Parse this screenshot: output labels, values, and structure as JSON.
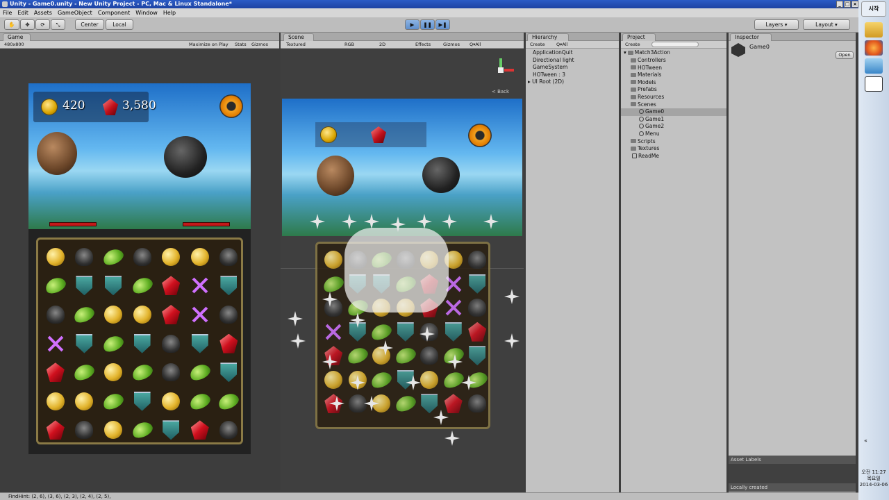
{
  "window": {
    "title": "Unity - Game0.unity - New Unity Project - PC, Mac & Linux Standalone*"
  },
  "menu": [
    "File",
    "Edit",
    "Assets",
    "GameObject",
    "Component",
    "Window",
    "Help"
  ],
  "toolbar": {
    "pivot": "Center",
    "space": "Local",
    "layers": "Layers",
    "layout": "Layout"
  },
  "game_panel": {
    "tab": "Game",
    "aspect": "480x800",
    "maximize": "Maximize on Play",
    "stats": "Stats",
    "gizmos": "Gizmos"
  },
  "scene_panel": {
    "tab": "Scene",
    "shading": "Textured",
    "render": "RGB",
    "mode2d": "2D",
    "effects": "Effects",
    "gizmos": "Gizmos",
    "search": "Q▾All",
    "back": "< Back"
  },
  "hierarchy": {
    "tab": "Hierarchy",
    "create": "Create",
    "search": "Q▾All",
    "items": [
      "ApplicationQuit",
      "Directional light",
      "GameSystem",
      "HOTween : 3",
      "▸ UI Root (2D)"
    ]
  },
  "project": {
    "tab": "Project",
    "create": "Create",
    "root": "Match3Action",
    "folders": [
      "Controllers",
      "HOTween",
      "Materials",
      "Models",
      "Prefabs",
      "Resources",
      "Scenes"
    ],
    "scenes": [
      "Game0",
      "Game1",
      "Game2",
      "Menu"
    ],
    "after": [
      "Scripts",
      "Textures"
    ],
    "file": "ReadMe"
  },
  "inspector": {
    "tab": "Inspector",
    "object": "Game0",
    "open": "Open",
    "asset_labels": "Asset Labels",
    "locally_created": "Locally created"
  },
  "game": {
    "coins": "420",
    "gems": "3,580"
  },
  "board_rows": [
    [
      "coin",
      "skull",
      "leaf",
      "skull",
      "coin",
      "coin",
      "skull"
    ],
    [
      "leaf",
      "shield",
      "shield",
      "leaf",
      "ruby",
      "sword",
      "shield"
    ],
    [
      "skull",
      "leaf",
      "coin",
      "coin",
      "ruby",
      "sword",
      "skull"
    ],
    [
      "sword",
      "shield",
      "leaf",
      "shield",
      "skull",
      "shield",
      "ruby"
    ],
    [
      "ruby",
      "leaf",
      "coin",
      "leaf",
      "skull",
      "leaf",
      "shield"
    ],
    [
      "coin",
      "coin",
      "leaf",
      "shield",
      "coin",
      "leaf",
      "leaf"
    ],
    [
      "ruby",
      "skull",
      "coin",
      "leaf",
      "shield",
      "ruby",
      "skull"
    ]
  ],
  "status": {
    "text": "FindHint: (2, 6), (3, 6), (2, 3), (2, 4), (2, 5),"
  },
  "taskbar": {
    "start": "시작",
    "time": "오전 11:27",
    "day": "목요일",
    "date": "2014-03-06"
  },
  "colors": {
    "title_bar": "#2b5bc6",
    "panel_bg": "#c2c2c2",
    "hp_red": "#c31919",
    "play_blue": "#5f8fcd"
  }
}
